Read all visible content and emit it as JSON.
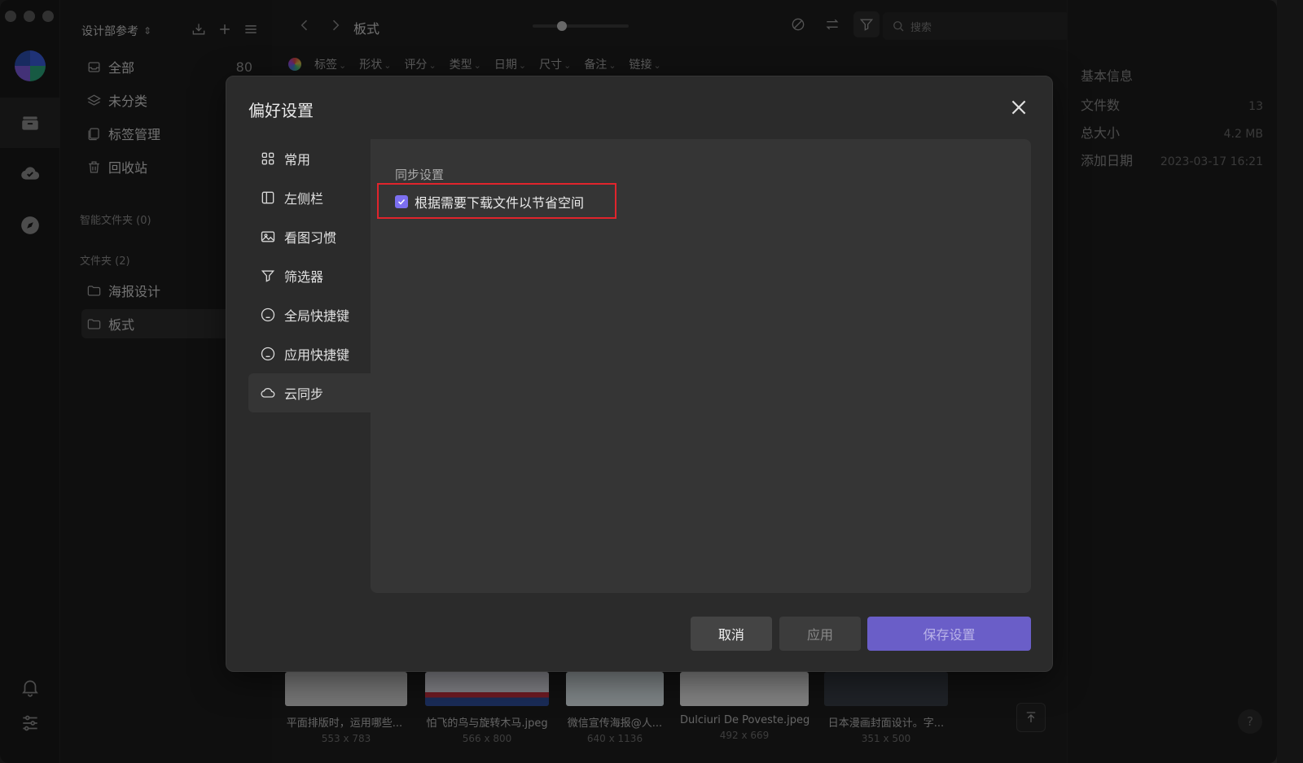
{
  "sidebar": {
    "library_name": "设计部参考",
    "items": [
      {
        "label": "全部",
        "count": "80"
      },
      {
        "label": "未分类"
      },
      {
        "label": "标签管理"
      },
      {
        "label": "回收站"
      }
    ],
    "smart_folders": "智能文件夹 (0)",
    "folders_header": "文件夹 (2)",
    "folders": [
      "海报设计",
      "板式"
    ]
  },
  "topbar": {
    "breadcrumb": "板式",
    "search_placeholder": "搜索"
  },
  "filters": [
    "标签",
    "形状",
    "评分",
    "类型",
    "日期",
    "尺寸",
    "备注",
    "链接"
  ],
  "thumbnails": [
    {
      "name": "平面排版时，运用哪些...",
      "dim": "553 x 783"
    },
    {
      "name": "怕飞的鸟与旋转木马.jpeg",
      "dim": "566 x 800"
    },
    {
      "name": "微信宣传海报@人...",
      "dim": "640 x 1136"
    },
    {
      "name": "Dulciuri De Poveste.jpeg",
      "dim": "492 x 669"
    },
    {
      "name": "日本漫画封面设计。字...",
      "dim": "351 x 500"
    }
  ],
  "inspector": {
    "title": "基本信息",
    "rows": [
      {
        "key": "文件数",
        "value": "13"
      },
      {
        "key": "总大小",
        "value": "4.2 MB"
      },
      {
        "key": "添加日期",
        "value": "2023-03-17 16:21"
      }
    ],
    "help": "?"
  },
  "modal": {
    "title": "偏好设置",
    "nav": [
      {
        "label": "常用",
        "icon": "grid-icon"
      },
      {
        "label": "左侧栏",
        "icon": "sidebar-icon"
      },
      {
        "label": "看图习惯",
        "icon": "image-icon"
      },
      {
        "label": "筛选器",
        "icon": "filter-icon"
      },
      {
        "label": "全局快捷键",
        "icon": "keyboard-icon"
      },
      {
        "label": "应用快捷键",
        "icon": "keyboard-icon"
      },
      {
        "label": "云同步",
        "icon": "cloud-icon"
      }
    ],
    "active_nav": "云同步",
    "section_label": "同步设置",
    "checkbox_label": "根据需要下载文件以节省空间",
    "checkbox_checked": true,
    "buttons": {
      "cancel": "取消",
      "apply": "应用",
      "save": "保存设置"
    },
    "accent_color": "#6a5ec8"
  }
}
